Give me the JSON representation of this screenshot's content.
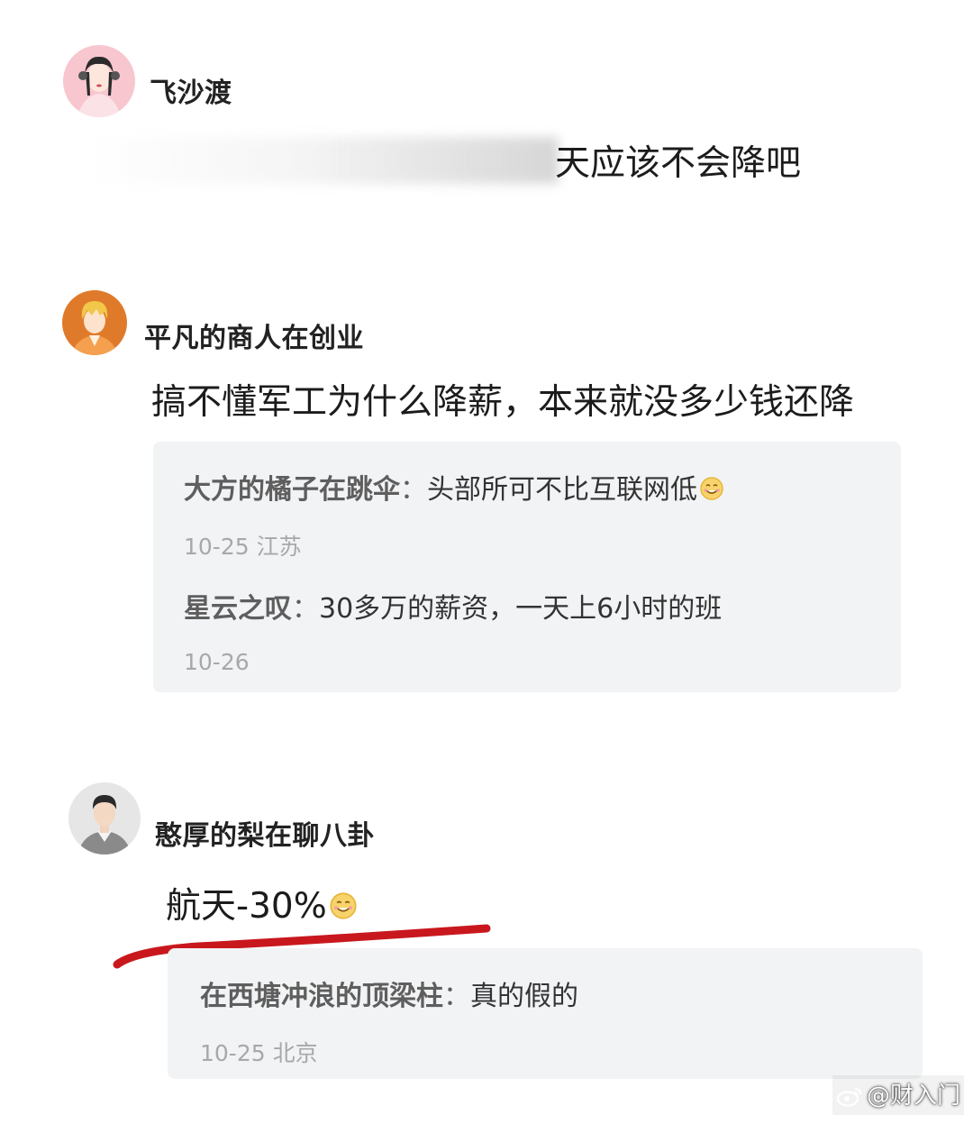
{
  "comments": [
    {
      "username": "飞沙渡",
      "text": "天应该不会降吧",
      "text_partially_obscured": true
    },
    {
      "username": "平凡的商人在创业",
      "text": "搞不懂军工为什么降薪，本来就没多少钱还降",
      "replies": [
        {
          "author": "大方的橘子在跳伞",
          "separator": "：",
          "text": "头部所可不比互联网低",
          "emoji": "smile-emoji",
          "meta": "10-25 江苏"
        },
        {
          "author": "星云之叹",
          "separator": "：",
          "text": "30多万的薪资，一天上6小时的班",
          "meta": "10-26"
        }
      ]
    },
    {
      "username": "憨厚的梨在聊八卦",
      "text": "航天-30%",
      "emoji": "smile-emoji",
      "underline_color": "#c8181e",
      "replies": [
        {
          "author": "在西塘冲浪的顶梁柱",
          "separator": "：",
          "text": "真的假的",
          "meta": "10-25 北京"
        }
      ]
    }
  ],
  "watermark": {
    "icon": "weibo-icon",
    "text": "@财入门"
  },
  "colors": {
    "reply_bg": "#f2f3f5",
    "meta_text": "#a8a8a8",
    "underline": "#c8181e"
  }
}
